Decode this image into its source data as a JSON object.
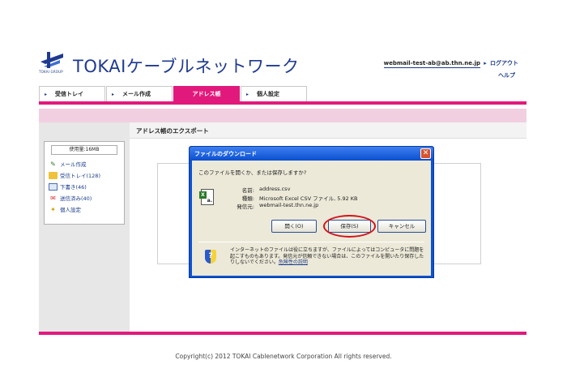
{
  "brand": {
    "logo_sub": "TOKAI GROUP",
    "name": "TOKAIケーブルネットワーク"
  },
  "header": {
    "user": "webmail-test-ab@ab.thn.ne.jp",
    "separator": "▸",
    "logout": "ログアウト",
    "help": "ヘルプ"
  },
  "tabs": [
    {
      "label": "受信トレイ",
      "active": false
    },
    {
      "label": "メール作成",
      "active": false
    },
    {
      "label": "アドレス帳",
      "active": true
    },
    {
      "label": "個人設定",
      "active": false
    }
  ],
  "sidebar": {
    "usage": "使用量:16MB",
    "items": [
      {
        "label": "メール作成",
        "icon": "compose-icon"
      },
      {
        "label": "受信トレイ(128)",
        "icon": "inbox-icon"
      },
      {
        "label": "下書き(46)",
        "icon": "draft-icon"
      },
      {
        "label": "送信済み(40)",
        "icon": "sent-icon"
      },
      {
        "label": "個人設定",
        "icon": "settings-icon"
      }
    ]
  },
  "content": {
    "title": "アドレス帳のエクスポート"
  },
  "dialog": {
    "title": "ファイルのダウンロード",
    "close_symbol": "✕",
    "question": "このファイルを開くか、または保存しますか?",
    "file": {
      "name_key": "名前:",
      "name": "address.csv",
      "type_key": "種類:",
      "type": "Microsoft Excel CSV ファイル, 5.92 KB",
      "from_key": "発信元:",
      "from": "webmail-test.thn.ne.jp"
    },
    "buttons": {
      "open": "開く(O)",
      "save": "保存(S)",
      "cancel": "キャンセル"
    },
    "warning": "インターネットのファイルは役に立ちますが、ファイルによってはコンピュータに問題を起こすものもあります。発信元が信頼できない場合は、このファイルを開いたり保存したりしないでください。",
    "warning_link": "危険性の説明"
  },
  "footer": {
    "copyright": "Copyright(c) 2012 TOKAI Cablenetwork Corporation All rights reserved."
  },
  "colors": {
    "accent": "#e2197c",
    "brand_blue": "#1f3a8f",
    "dialog_blue": "#0c54d6"
  }
}
